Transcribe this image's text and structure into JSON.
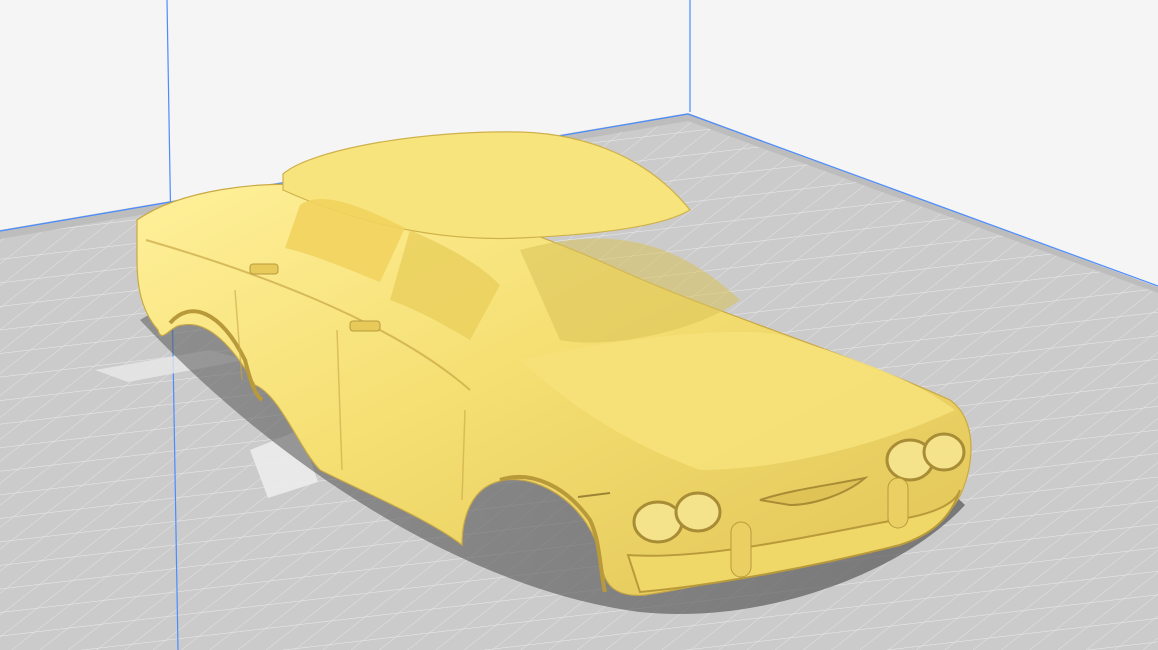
{
  "app": {
    "view": "3D viewport"
  },
  "scene": {
    "object": "car-body-model",
    "object_color": "#f5df72",
    "build_plate_color": "#c8c8c8",
    "background_color": "#f4f4f4",
    "axis_color": "#4a8cff"
  }
}
